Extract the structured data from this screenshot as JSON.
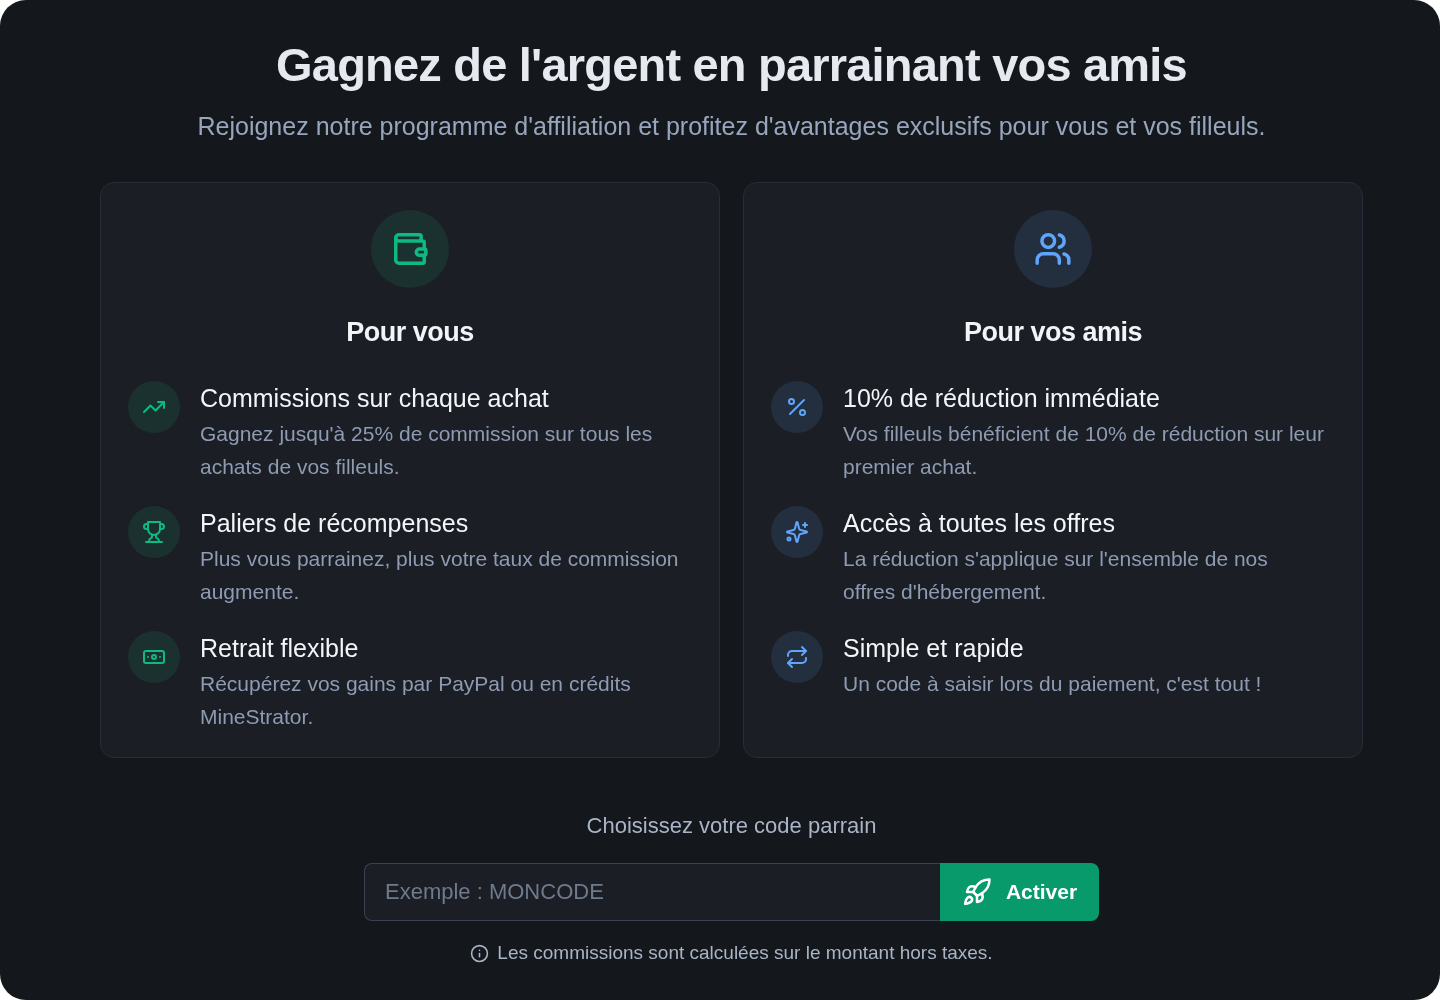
{
  "header": {
    "title": "Gagnez de l'argent en parrainant vos amis",
    "subtitle": "Rejoignez notre programme d'affiliation et profitez d'avantages exclusifs pour vous et vos filleuls."
  },
  "cards": [
    {
      "title": "Pour vous",
      "color": "#10b981",
      "features": [
        {
          "title": "Commissions sur chaque achat",
          "description": "Gagnez jusqu'à 25% de commission sur tous les achats de vos filleuls."
        },
        {
          "title": "Paliers de récompenses",
          "description": "Plus vous parrainez, plus votre taux de commission augmente."
        },
        {
          "title": "Retrait flexible",
          "description": "Récupérez vos gains par PayPal ou en crédits MineStrator."
        }
      ]
    },
    {
      "title": "Pour vos amis",
      "color": "#60a5fa",
      "features": [
        {
          "title": "10% de réduction immédiate",
          "description": "Vos filleuls bénéficient de 10% de réduction sur leur premier achat."
        },
        {
          "title": "Accès à toutes les offres",
          "description": "La réduction s'applique sur l'ensemble de nos offres d'hébergement."
        },
        {
          "title": "Simple et rapide",
          "description": "Un code à saisir lors du paiement, c'est tout !"
        }
      ]
    }
  ],
  "code_form": {
    "label": "Choisissez votre code parrain",
    "input": {
      "placeholder": "Exemple : MONCODE"
    },
    "button": {
      "label": "Activer"
    },
    "note": "Les commissions sont calculées sur le montant hors taxes."
  }
}
